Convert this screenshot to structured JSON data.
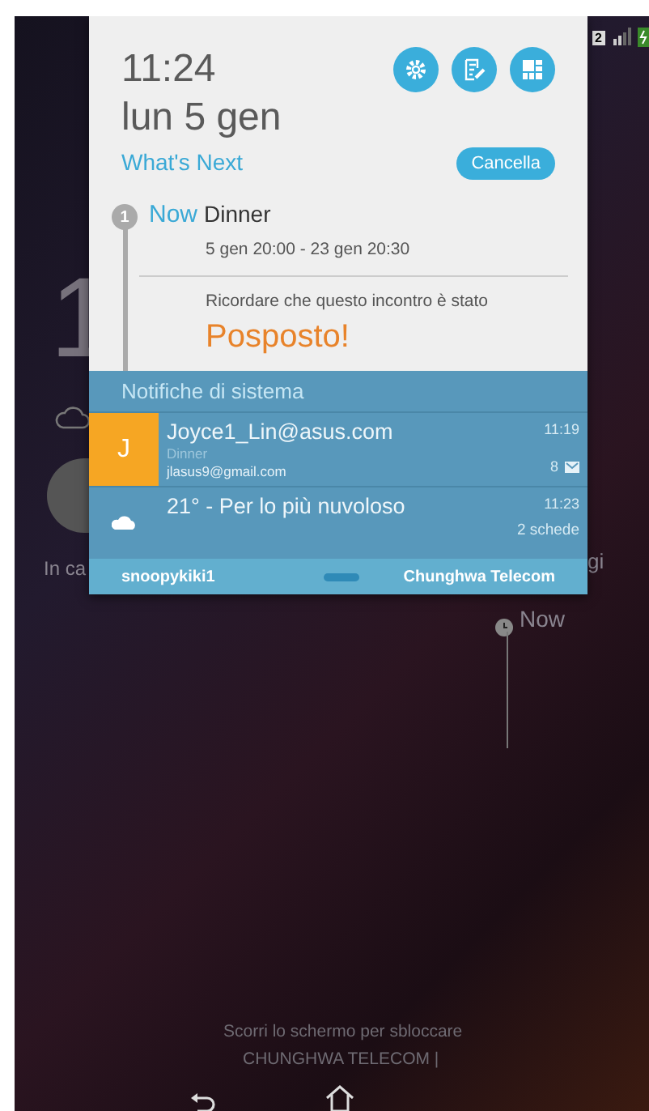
{
  "lock_screen": {
    "clock_fragment": "1",
    "camera_label_fragment": "In ca",
    "right_label_fragment": "gi",
    "next_label": "Now",
    "unlock_hint": "Scorri lo schermo per sbloccare",
    "carrier": "CHUNGHWA TELECOM |"
  },
  "status_bar": {
    "sim_slot": "2"
  },
  "panel": {
    "time": "11:24",
    "date": "lun 5 gen",
    "section_title": "What's Next",
    "clear_button": "Cancella",
    "event": {
      "badge": "1",
      "when": "Now",
      "title": "Dinner",
      "range": "5 gen 20:00 - 23 gen 20:30",
      "note": "Ricordare che questo incontro è stato",
      "status": "Posposto!"
    },
    "notifications_title": "Notifiche di sistema",
    "notifications": [
      {
        "kind": "mail",
        "avatar": "J",
        "title": "Joyce1_Lin@asus.com",
        "subtitle": "Dinner",
        "detail": "jlasus9@gmail.com",
        "time": "11:19",
        "count": "8"
      },
      {
        "kind": "weather",
        "title": "21° - Per lo più nuvoloso",
        "time": "11:23",
        "detail": "2 schede"
      }
    ],
    "footer": {
      "account": "snoopykiki1",
      "carrier": "Chunghwa Telecom"
    }
  }
}
